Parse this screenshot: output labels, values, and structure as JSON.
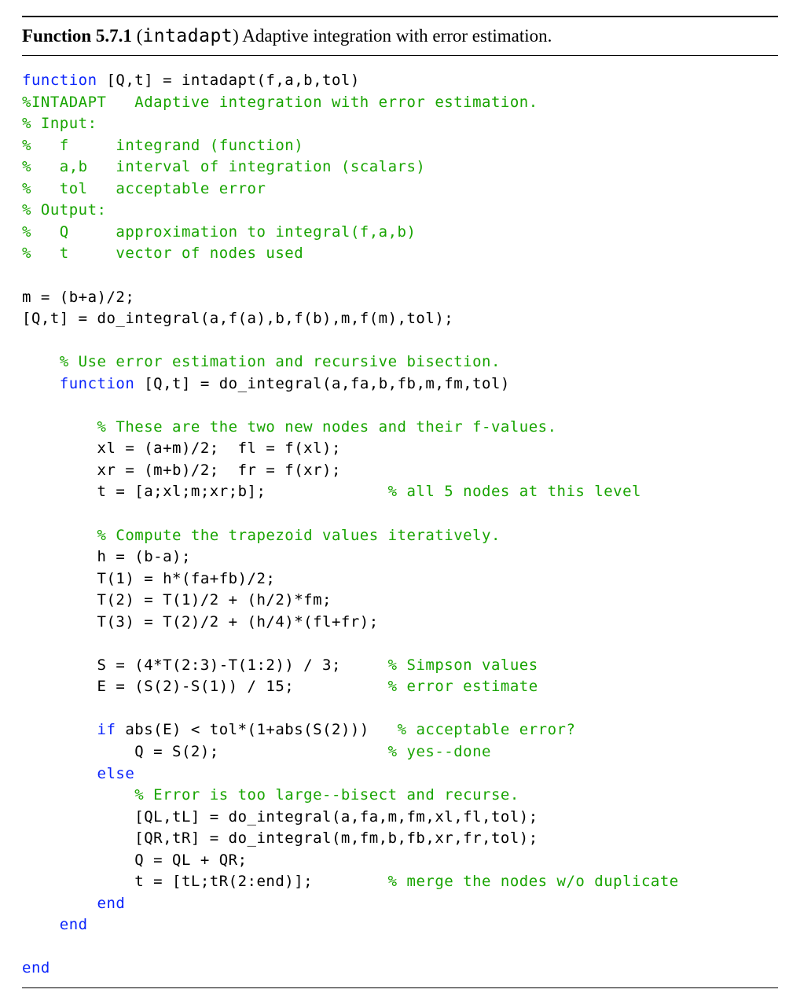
{
  "header": {
    "label": "Function 5.7.1",
    "fname": "intadapt",
    "desc": "Adaptive integration with error estimation."
  },
  "code": {
    "l01_kw": "function",
    "l01_rest": " [Q,t] = intadapt(f,a,b,tol)",
    "l02_com": "%INTADAPT   Adaptive integration with error estimation.",
    "l03_com": "% Input:",
    "l04_com": "%   f     integrand (function)",
    "l05_com": "%   a,b   interval of integration (scalars)",
    "l06_com": "%   tol   acceptable error",
    "l07_com": "% Output:",
    "l08_com": "%   Q     approximation to integral(f,a,b)",
    "l09_com": "%   t     vector of nodes used",
    "l11": "m = (b+a)/2;",
    "l12": "[Q,t] = do_integral(a,f(a),b,f(b),m,f(m),tol);",
    "l14_com": "    % Use error estimation and recursive bisection.",
    "l15a": "    ",
    "l15_kw": "function",
    "l15b": " [Q,t] = do_integral(a,fa,b,fb,m,fm,tol)",
    "l17_com": "        % These are the two new nodes and their f-values.",
    "l18": "        xl = (a+m)/2;  fl = f(xl);",
    "l19": "        xr = (m+b)/2;  fr = f(xr);",
    "l20a": "        t = [a;xl;m;xr;b];             ",
    "l20_com": "% all 5 nodes at this level",
    "l22_com": "        % Compute the trapezoid values iteratively.",
    "l23": "        h = (b-a);",
    "l24": "        T(1) = h*(fa+fb)/2;",
    "l25": "        T(2) = T(1)/2 + (h/2)*fm;",
    "l26": "        T(3) = T(2)/2 + (h/4)*(fl+fr);",
    "l28a": "        S = (4*T(2:3)-T(1:2)) / 3;     ",
    "l28_com": "% Simpson values",
    "l29a": "        E = (S(2)-S(1)) / 15;          ",
    "l29_com": "% error estimate",
    "l31a": "        ",
    "l31_kw": "if",
    "l31b": " abs(E) < tol*(1+abs(S(2)))   ",
    "l31_com": "% acceptable error?",
    "l32a": "            Q = S(2);                  ",
    "l32_com": "% yes--done",
    "l33a": "        ",
    "l33_kw": "else",
    "l34_com": "            % Error is too large--bisect and recurse.",
    "l35": "            [QL,tL] = do_integral(a,fa,m,fm,xl,fl,tol);",
    "l36": "            [QR,tR] = do_integral(m,fm,b,fb,xr,fr,tol);",
    "l37": "            Q = QL + QR;",
    "l38a": "            t = [tL;tR(2:end)];        ",
    "l38_com": "% merge the nodes w/o duplicate",
    "l39a": "        ",
    "l39_kw": "end",
    "l40a": "    ",
    "l40_kw": "end",
    "l42_kw": "end"
  }
}
